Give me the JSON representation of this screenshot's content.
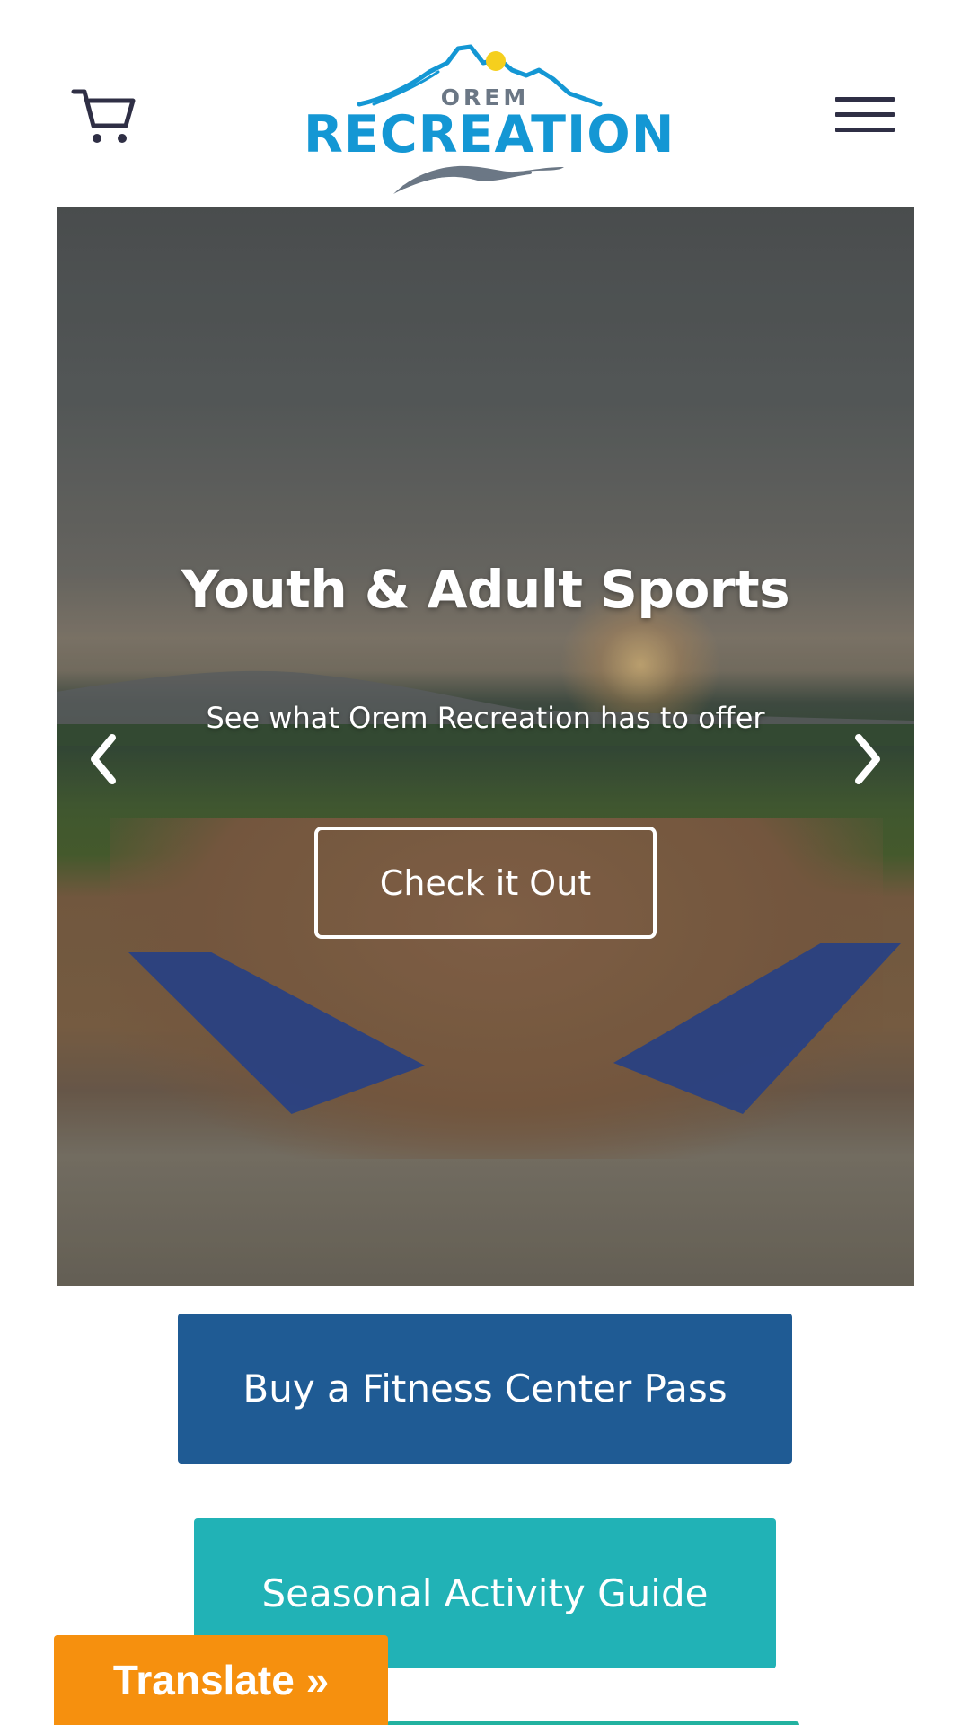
{
  "header": {
    "logo_top": "OREM",
    "logo_main": "RECREATION",
    "cart_icon": "cart-icon",
    "menu_icon": "hamburger-menu-icon"
  },
  "hero": {
    "title": "Youth & Adult Sports",
    "subtitle": "See what Orem Recreation has to offer",
    "cta_label": "Check it Out",
    "prev_icon": "chevron-left-icon",
    "next_icon": "chevron-right-icon"
  },
  "buttons": {
    "fitness_pass": "Buy a Fitness Center Pass",
    "activity_guide": "Seasonal Activity Guide"
  },
  "translate": {
    "label": "Translate »"
  },
  "colors": {
    "brand_blue": "#1497d4",
    "dark_blue": "#1f5b94",
    "teal": "#21b2b6",
    "orange": "#f6900e",
    "sun_yellow": "#f5cf1d",
    "icon_dark": "#2f2f45"
  }
}
